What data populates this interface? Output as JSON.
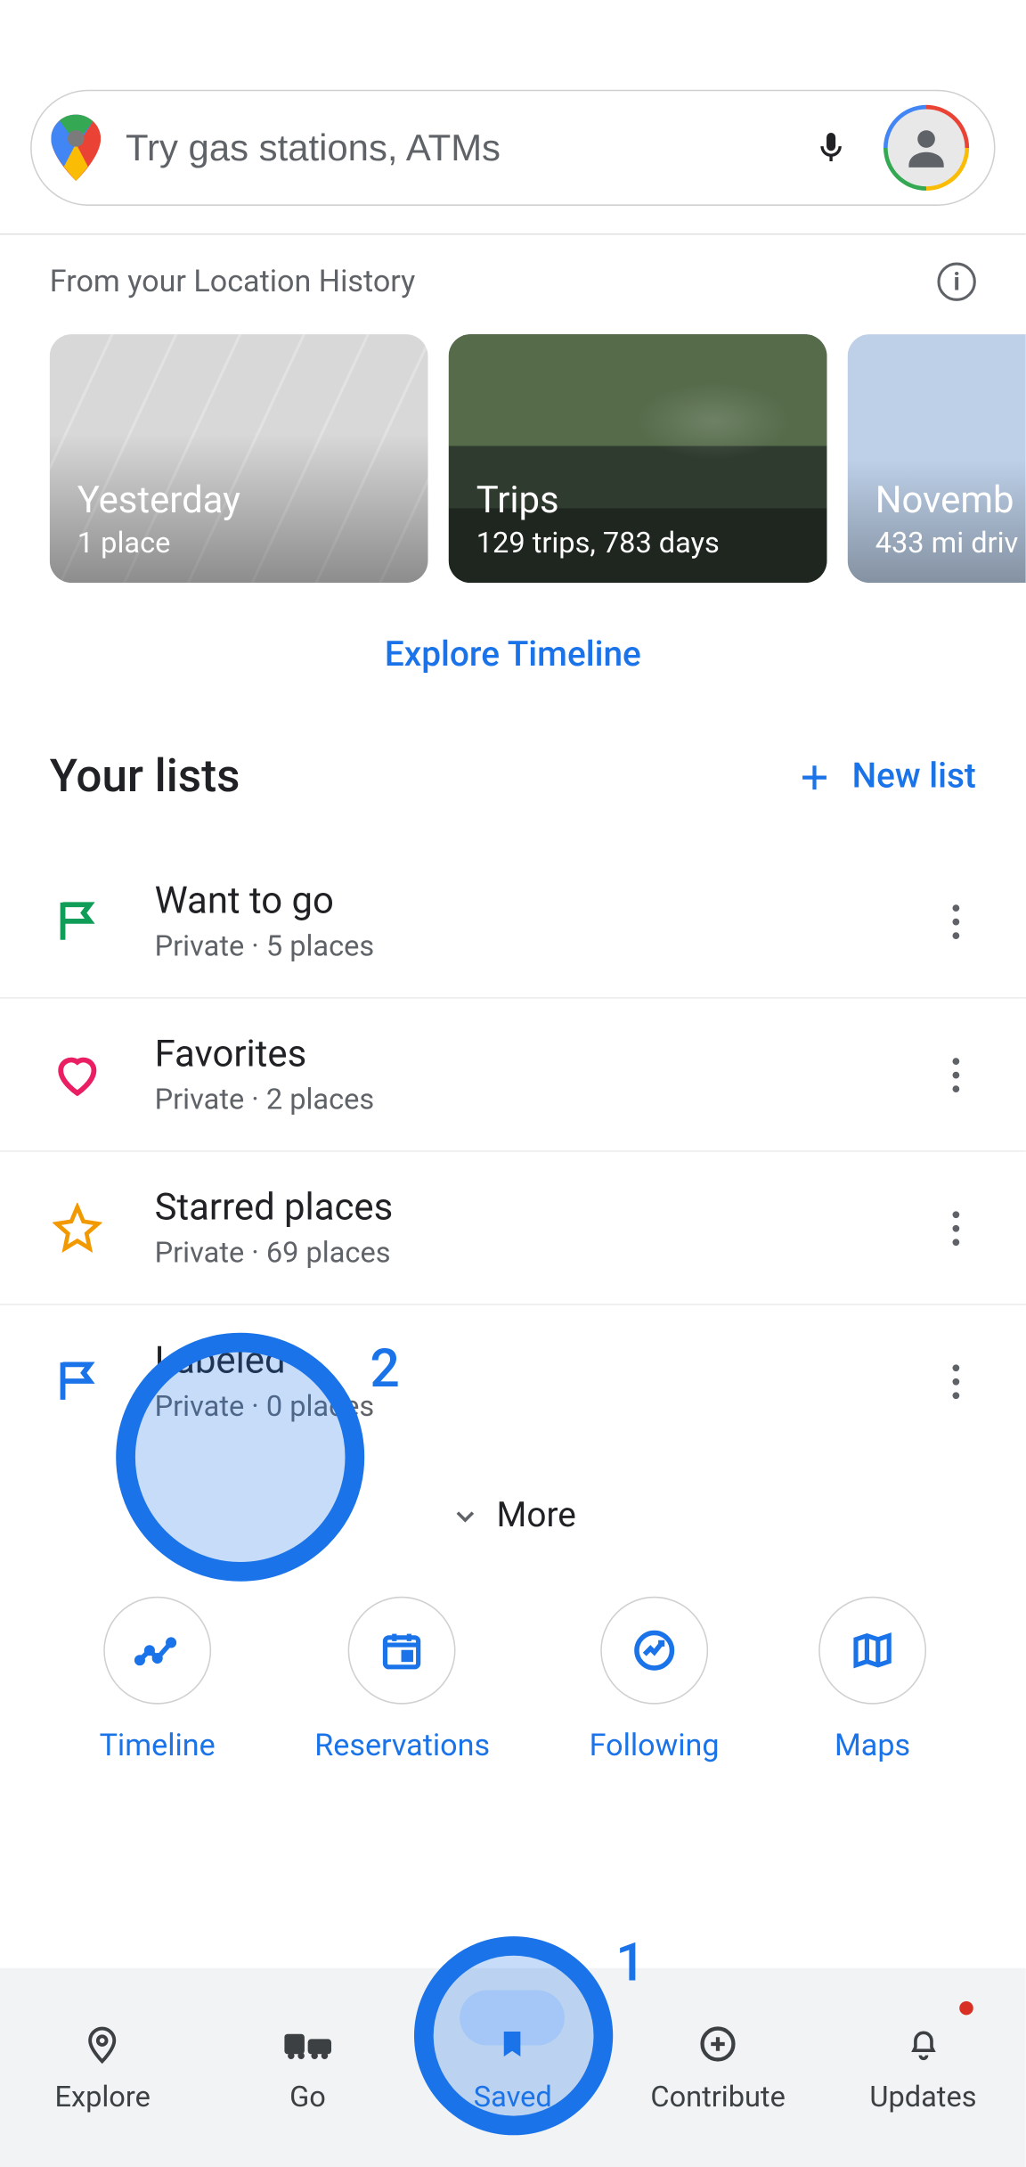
{
  "search": {
    "placeholder": "Try gas stations, ATMs"
  },
  "visited": {
    "subtitle": "From your Location History",
    "cards": [
      {
        "title": "Yesterday",
        "sub": "1 place"
      },
      {
        "title": "Trips",
        "sub": "129 trips,  783 days"
      },
      {
        "title": "Novemb",
        "sub": "433 mi driv"
      }
    ],
    "explore_link": "Explore Timeline"
  },
  "lists": {
    "title": "Your lists",
    "new_label": "New list",
    "items": [
      {
        "name": "Want to go",
        "meta": "Private · 5 places",
        "icon": "flag-green"
      },
      {
        "name": "Favorites",
        "meta": "Private · 2 places",
        "icon": "heart-pink"
      },
      {
        "name": "Starred places",
        "meta": "Private · 69 places",
        "icon": "star-orange"
      },
      {
        "name": "Labeled",
        "meta": "Private · 0 places",
        "icon": "flag-blue"
      }
    ],
    "more_label": "More"
  },
  "circles": [
    {
      "label": "Timeline",
      "icon": "timeline"
    },
    {
      "label": "Reservations",
      "icon": "calendar"
    },
    {
      "label": "Following",
      "icon": "trend"
    },
    {
      "label": "Maps",
      "icon": "map"
    }
  ],
  "nav": [
    {
      "label": "Explore",
      "icon": "pin"
    },
    {
      "label": "Go",
      "icon": "commute"
    },
    {
      "label": "Saved",
      "icon": "bookmark"
    },
    {
      "label": "Contribute",
      "icon": "plus-circle"
    },
    {
      "label": "Updates",
      "icon": "bell"
    }
  ],
  "highlights": [
    {
      "badge": "1"
    },
    {
      "badge": "2"
    }
  ]
}
